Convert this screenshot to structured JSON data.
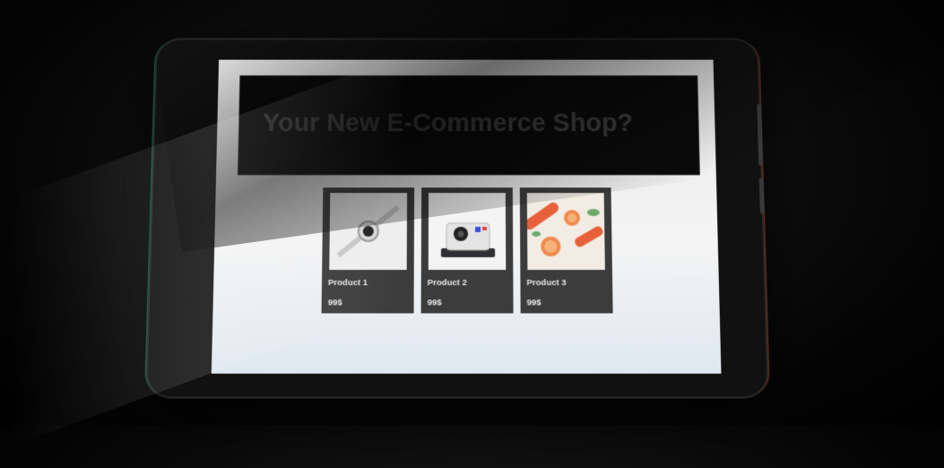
{
  "shop": {
    "hero_title": "Your New E-Commerce Shop?",
    "products": [
      {
        "name": "Product 1",
        "price": "99$",
        "image": "watch"
      },
      {
        "name": "Product 2",
        "price": "99$",
        "image": "camera"
      },
      {
        "name": "Product 3",
        "price": "99$",
        "image": "citrus"
      }
    ]
  },
  "colors": {
    "hero_bg": "#0b0b0b",
    "card_bg": "#3c3c3c",
    "screen_bg": "#f0f0f0",
    "accent_orange": "#e8603a"
  }
}
